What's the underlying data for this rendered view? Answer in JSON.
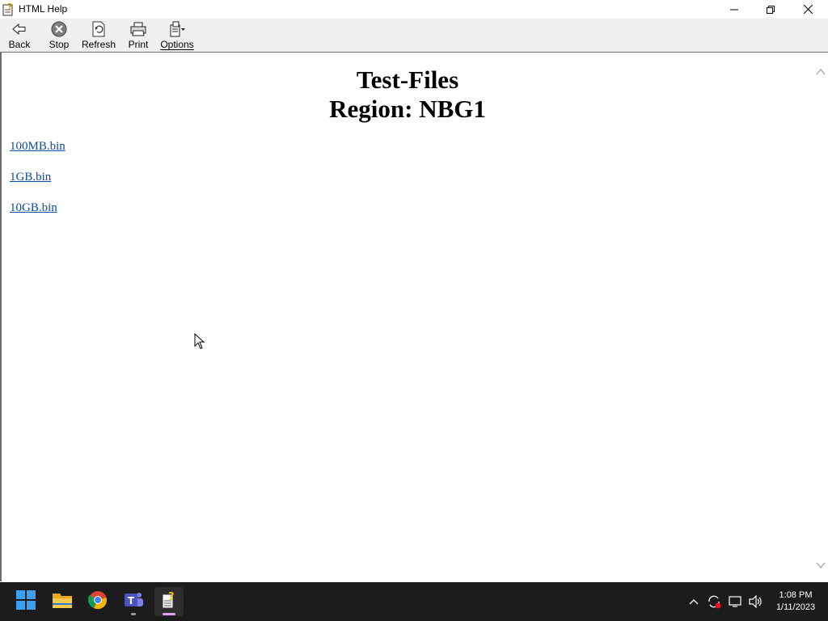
{
  "window": {
    "title": "HTML Help",
    "icon": "help-book-icon"
  },
  "toolbar": {
    "buttons": [
      {
        "label": "Back",
        "icon": "back-arrow-icon"
      },
      {
        "label": "Stop",
        "icon": "stop-icon"
      },
      {
        "label": "Refresh",
        "icon": "refresh-icon"
      },
      {
        "label": "Print",
        "icon": "printer-icon"
      },
      {
        "label": "Options",
        "icon": "options-icon"
      }
    ]
  },
  "content": {
    "heading_line1": "Test-Files",
    "heading_line2": "Region: NBG1",
    "links": [
      {
        "label": "100MB.bin"
      },
      {
        "label": "1GB.bin"
      },
      {
        "label": "10GB.bin"
      }
    ],
    "link_color": "#0b4ea2"
  },
  "taskbar": {
    "apps": [
      "start-icon",
      "file-explorer-icon",
      "chrome-icon",
      "teams-icon",
      "html-help-icon"
    ],
    "active_app": "html-help-icon",
    "tray": [
      "chevron-up-icon",
      "sync-alert-icon",
      "display-icon",
      "volume-icon"
    ],
    "time": "1:08 PM",
    "date": "1/11/2023"
  }
}
